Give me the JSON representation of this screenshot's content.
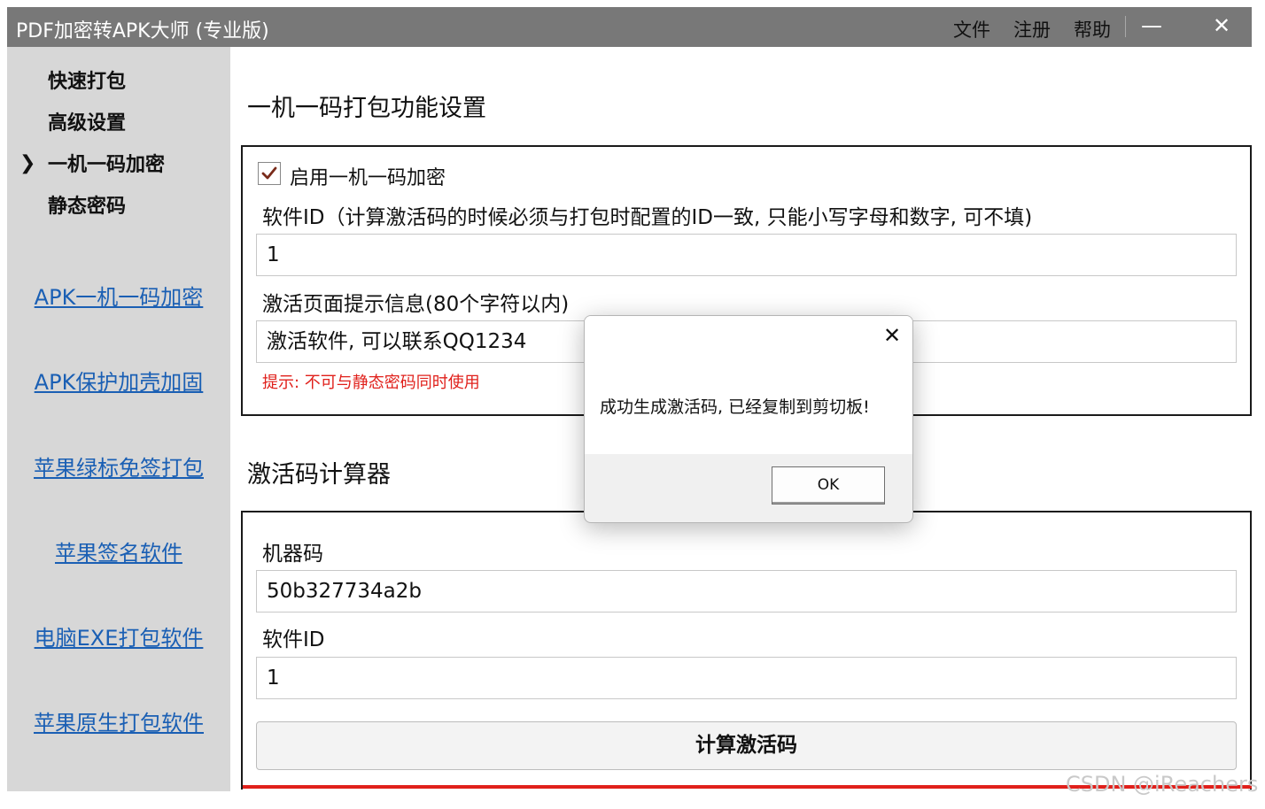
{
  "window": {
    "title": "PDF加密转APK大师 (专业版)",
    "menu": {
      "file": "文件",
      "register": "注册",
      "help": "帮助"
    },
    "minimize_glyph": "—",
    "close_glyph": "✕"
  },
  "sidebar": {
    "active_marker": "❯",
    "nav_items": [
      {
        "label": "快速打包"
      },
      {
        "label": "高级设置"
      },
      {
        "label": "一机一码加密",
        "active": true
      },
      {
        "label": "静态密码"
      }
    ],
    "links": [
      {
        "label": "APK一机一码加密"
      },
      {
        "label": "APK保护加壳加固"
      },
      {
        "label": "苹果绿标免签打包"
      },
      {
        "label": "苹果签名软件"
      },
      {
        "label": "电脑EXE打包软件"
      },
      {
        "label": "苹果原生打包软件"
      }
    ],
    "link_color": "#1a5fb4"
  },
  "settings": {
    "title": "一机一码打包功能设置",
    "enable_checkbox": {
      "label": "启用一机一码加密",
      "checked": true
    },
    "software_id_label": "软件ID（计算激活码的时候必须与打包时配置的ID一致, 只能小写字母和数字, 可不填)",
    "software_id_value": "1",
    "activation_hint_label": "激活页面提示信息(80个字符以内)",
    "activation_hint_value": "激活软件, 可以联系QQ1234",
    "warning": "提示: 不可与静态密码同时使用",
    "warning_color": "#e0201b"
  },
  "calculator": {
    "title": "激活码计算器",
    "machine_code_label": "机器码",
    "machine_code_value": "50b327734a2b",
    "software_id_label": "软件ID",
    "software_id_value": "1",
    "compute_button": "计算激活码"
  },
  "dialog": {
    "message": "成功生成激活码, 已经复制到剪切板!",
    "ok_label": "OK",
    "close_glyph": "✕"
  },
  "watermark": "CSDN @iReachers"
}
